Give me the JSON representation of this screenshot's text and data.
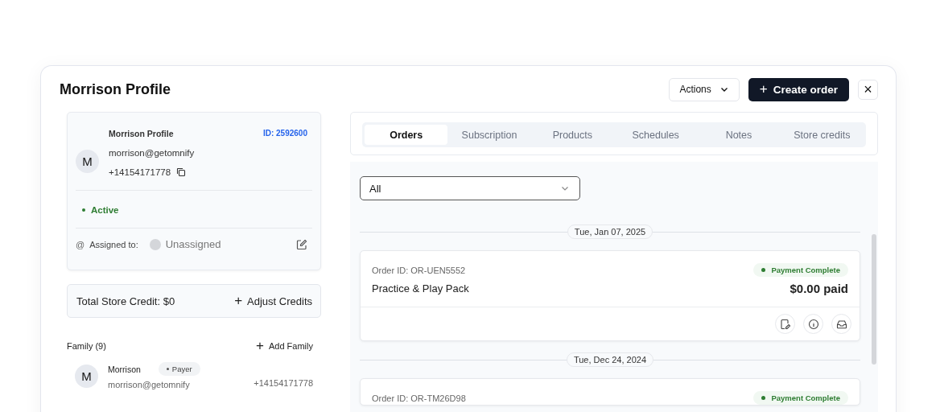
{
  "modal": {
    "title": "Morrison Profile",
    "actions_button": "Actions",
    "create_button": {
      "icon": "+",
      "label": "Create order"
    },
    "close": "×"
  },
  "profile": {
    "name": "Morrison Profile",
    "id": "ID: 2592600",
    "avatar": "M",
    "email": "morrison@getomnify",
    "phone": "+14154171778",
    "status": "Active",
    "assigned_label": "Assigned to:",
    "assigned_icon": "@",
    "assignee": "Unassigned"
  },
  "credit": {
    "total": "Total Store Credit: $0",
    "adjust": {
      "icon": "+",
      "label": "Adjust Credits"
    }
  },
  "family": {
    "title": "Family (9)",
    "add": {
      "icon": "+",
      "label": "Add Family"
    },
    "members": [
      {
        "avatar": "M",
        "name": "Morrison",
        "tag": "Payer",
        "email": "morrison@getomnify",
        "phone": "+14154171778"
      }
    ]
  },
  "tabs": [
    {
      "label": "Orders",
      "selected": true
    },
    {
      "label": "Subscription",
      "selected": false
    },
    {
      "label": "Products",
      "selected": false
    },
    {
      "label": "Schedules",
      "selected": false
    },
    {
      "label": "Notes",
      "selected": false
    },
    {
      "label": "Store credits",
      "selected": false
    }
  ],
  "filter": {
    "value": "All"
  },
  "order_groups": [
    {
      "date": "Tue, Jan 07, 2025",
      "orders": [
        {
          "order_id": "Order ID: OR-UEN5552",
          "status": "Payment Complete",
          "color": "#2e7d32",
          "name": "Practice & Play Pack",
          "amount": "$0.00 paid"
        }
      ]
    },
    {
      "date": "Tue, Dec 24, 2024",
      "orders": [
        {
          "order_id": "Order ID: OR-TM26D98",
          "status": "Payment Complete",
          "color": "#2e7d32"
        }
      ]
    }
  ]
}
